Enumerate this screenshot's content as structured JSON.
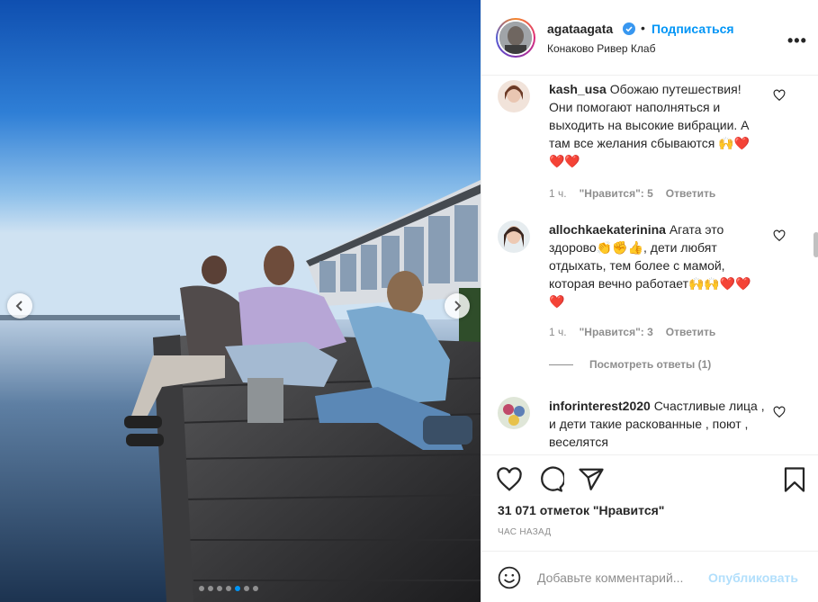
{
  "post": {
    "username": "agataagata",
    "follow_label": "Подписаться",
    "location": "Конаково Ривер Клаб",
    "more_label": "•••",
    "verified_icon": "verified-badge-icon",
    "media": {
      "slides_total": 7,
      "active_slide": 5
    }
  },
  "comments": [
    {
      "username": "kash_usa",
      "text": "Обожаю путешествия! Они помогают наполняться и выходить на высокие вибрации. А там все желания сбываются 🙌❤️❤️❤️",
      "time": "1 ч.",
      "likes": "\"Нравится\": 5",
      "reply": "Ответить"
    },
    {
      "username": "allochkaekaterinina",
      "text": "Агата это здорово👏✊👍, дети любят отдыхать, тем более с мамой, которая вечно работает🙌🙌❤️❤️❤️",
      "time": "1 ч.",
      "likes": "\"Нравится\": 3",
      "reply": "Ответить",
      "view_replies": "Посмотреть ответы (1)"
    },
    {
      "username": "inforinterest2020",
      "text": "Счастливые лица , и дети такие раскованные , поют , веселятся"
    }
  ],
  "actions": {
    "like_icon": "heart-icon",
    "comment_icon": "comment-icon",
    "share_icon": "share-icon",
    "save_icon": "bookmark-icon",
    "likes_count": "31 071 отметок \"Нравится\"",
    "time_ago": "ЧАС НАЗАД"
  },
  "add_comment": {
    "placeholder": "Добавьте комментарий...",
    "publish_label": "Опубликовать"
  },
  "colors": {
    "accent": "#0095f6",
    "text": "#262626",
    "muted": "#8e8e8e",
    "publish_disabled": "#b2dffc"
  }
}
